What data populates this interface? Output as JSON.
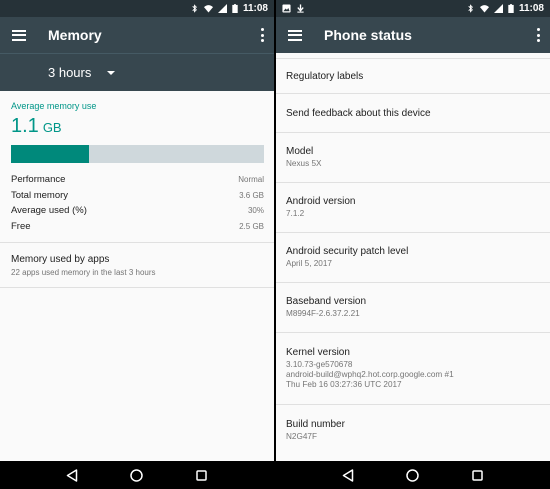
{
  "left": {
    "status": {
      "time": "11:08"
    },
    "appbar": {
      "title": "Memory"
    },
    "period": {
      "value": "3 hours"
    },
    "memory": {
      "caption": "Average memory use",
      "value": "1.1",
      "unit": "GB",
      "usage_fraction": 0.31,
      "stats": [
        {
          "label": "Performance",
          "value": "Normal"
        },
        {
          "label": "Total memory",
          "value": "3.6 GB"
        },
        {
          "label": "Average used (%)",
          "value": "30%"
        },
        {
          "label": "Free",
          "value": "2.5 GB"
        }
      ]
    },
    "apps": {
      "title": "Memory used by apps",
      "subtitle": "22 apps used memory in the last 3 hours"
    }
  },
  "right": {
    "status": {
      "time": "11:08"
    },
    "appbar": {
      "title": "Phone status"
    },
    "items": [
      {
        "title": "Regulatory labels",
        "lines": []
      },
      {
        "title": "Send feedback about this device",
        "lines": []
      },
      {
        "title": "Model",
        "lines": [
          "Nexus 5X"
        ]
      },
      {
        "title": "Android version",
        "lines": [
          "7.1.2"
        ]
      },
      {
        "title": "Android security patch level",
        "lines": [
          "April 5, 2017"
        ]
      },
      {
        "title": "Baseband version",
        "lines": [
          "M8994F-2.6.37.2.21"
        ]
      },
      {
        "title": "Kernel version",
        "lines": [
          "3.10.73-ge570678",
          "android-build@wphq2.hot.corp.google.com #1",
          "Thu Feb 16 03:27:36 UTC 2017"
        ]
      },
      {
        "title": "Build number",
        "lines": [
          "N2G47F"
        ]
      }
    ]
  },
  "icons": {
    "status_left": [
      "image-icon",
      "download-icon"
    ],
    "status_right": [
      "bluetooth-icon",
      "wifi-icon",
      "signal-icon",
      "battery-icon"
    ],
    "nav": [
      "back-icon",
      "home-icon",
      "recents-icon"
    ]
  },
  "colors": {
    "statusbar": "#263238",
    "appbar": "#37474f",
    "accent": "#009688",
    "bar_fill": "#00897b",
    "bar_track": "#cfd8dc"
  }
}
